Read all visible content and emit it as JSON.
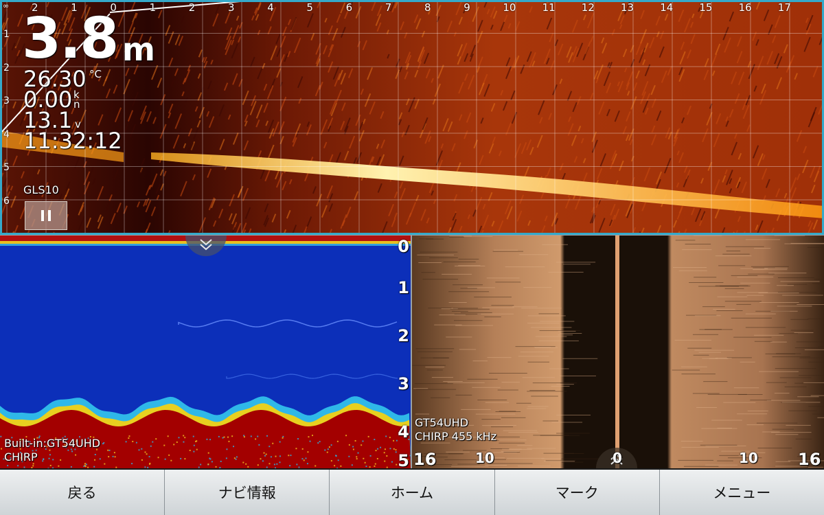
{
  "live_pane": {
    "x_scale": [
      "∞",
      "2",
      "1",
      "0",
      "1",
      "2",
      "3",
      "4",
      "5",
      "6",
      "7",
      "8",
      "9",
      "10",
      "11",
      "12",
      "13",
      "14",
      "15",
      "16",
      "17"
    ],
    "y_scale": [
      "1",
      "2",
      "3",
      "4",
      "5",
      "6"
    ],
    "depth": "3.8",
    "depth_unit": "m",
    "water_temp": "26.30",
    "temp_unit": "°C",
    "speed": "0.00",
    "speed_unit_top": "k",
    "speed_unit_bottom": "n",
    "voltage": "13.1",
    "voltage_unit": "v",
    "time": "11:32:12",
    "transducer": "GLS10",
    "pause_button": "pause-icon"
  },
  "sonar_2d": {
    "source": "Built-in:GT54UHD",
    "mode": "CHIRP",
    "depth_scale": [
      "0",
      "1",
      "2",
      "3",
      "4",
      "5"
    ],
    "collapse_icon": "chevron-double-down-icon"
  },
  "side_view": {
    "transducer": "GT54UHD",
    "frequency": "CHIRP 455 kHz",
    "range_scale": [
      "16",
      "10",
      "0",
      "10",
      "16"
    ],
    "expand_icon": "chevron-double-up-icon"
  },
  "softkeys": [
    "戻る",
    "ナビ情報",
    "ホーム",
    "マーク",
    "メニュー"
  ],
  "colors": {
    "frame_accent": "#35a9c9",
    "sonar_background": "#0c2fb9",
    "bottom_echo": "#a30000",
    "side_scan": "#c28a5e"
  }
}
